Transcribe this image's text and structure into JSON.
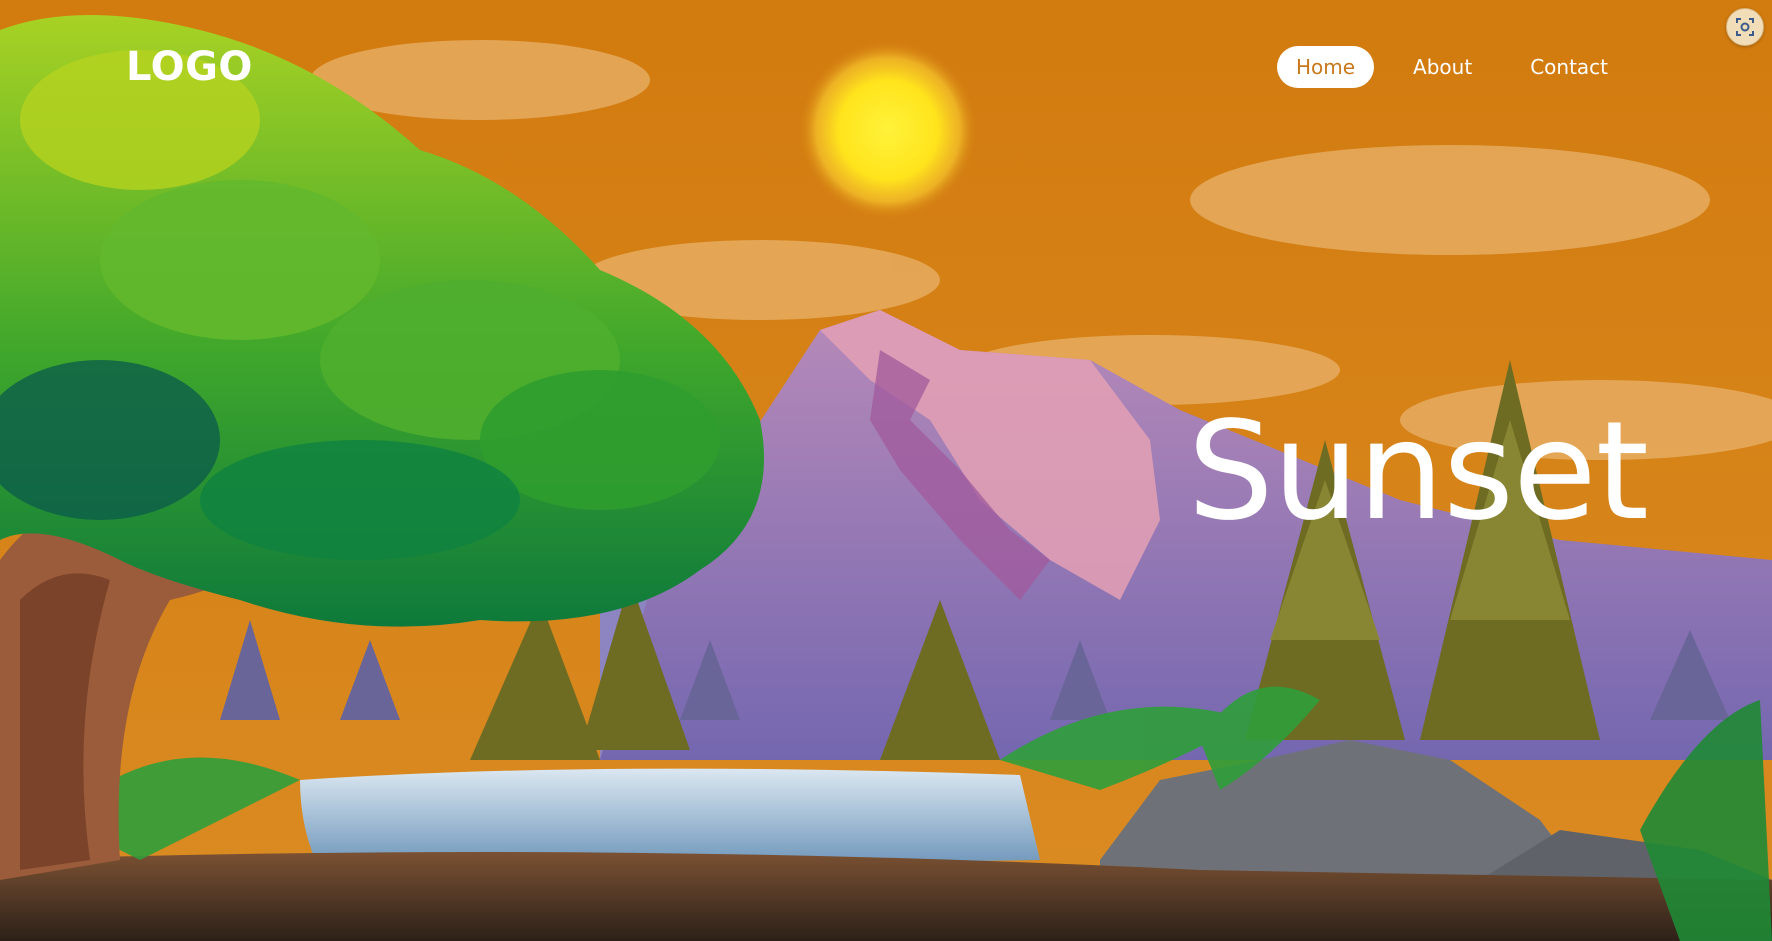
{
  "brand": {
    "logo_text": "LOGO"
  },
  "nav": {
    "items": [
      {
        "label": "Home",
        "active": true
      },
      {
        "label": "About",
        "active": false
      },
      {
        "label": "Contact",
        "active": false
      }
    ]
  },
  "hero": {
    "title": "Sunset"
  },
  "overlay": {
    "screenshot_icon": "screenshot-capture-icon"
  },
  "colors": {
    "sky": "#d27e10",
    "sun": "#ffe41c",
    "nav_active_text": "#c9781a",
    "text": "#ffffff"
  }
}
